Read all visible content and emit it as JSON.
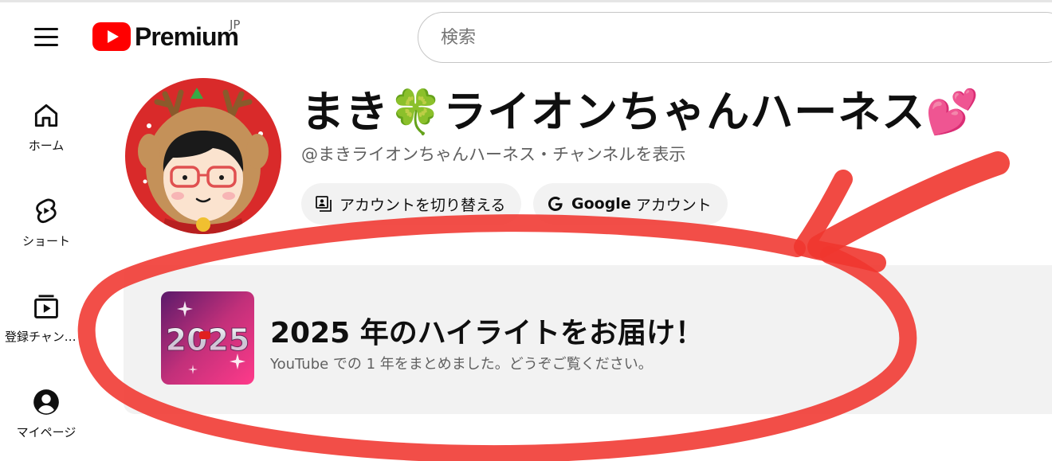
{
  "header": {
    "logo_text": "Premium",
    "region": "JP",
    "search_placeholder": "検索"
  },
  "sidebar": {
    "items": [
      {
        "label": "ホーム",
        "icon": "home-icon"
      },
      {
        "label": "ショート",
        "icon": "shorts-icon"
      },
      {
        "label": "登録チャンネル",
        "icon": "subscriptions-icon"
      },
      {
        "label": "マイページ",
        "icon": "account-icon"
      }
    ]
  },
  "channel": {
    "name": "まき🍀ライオンちゃんハーネス💕",
    "handle": "@まきライオンちゃんハーネス",
    "separator": "・",
    "view_channel_label": "チャンネルを表示",
    "switch_account_label": "アカウントを切り替える",
    "google_bold": "Google",
    "google_account_label": "アカウント"
  },
  "highlight": {
    "title": "2025 年のハイライトをお届け！",
    "subtitle": "YouTube での 1 年をまとめました。どうぞご覧ください。",
    "thumb_text": "2025"
  },
  "colors": {
    "brand_red": "#ff0000",
    "annotation_red": "#f0362f",
    "card_bg": "#f2f2f2",
    "secondary_text": "#606060"
  }
}
